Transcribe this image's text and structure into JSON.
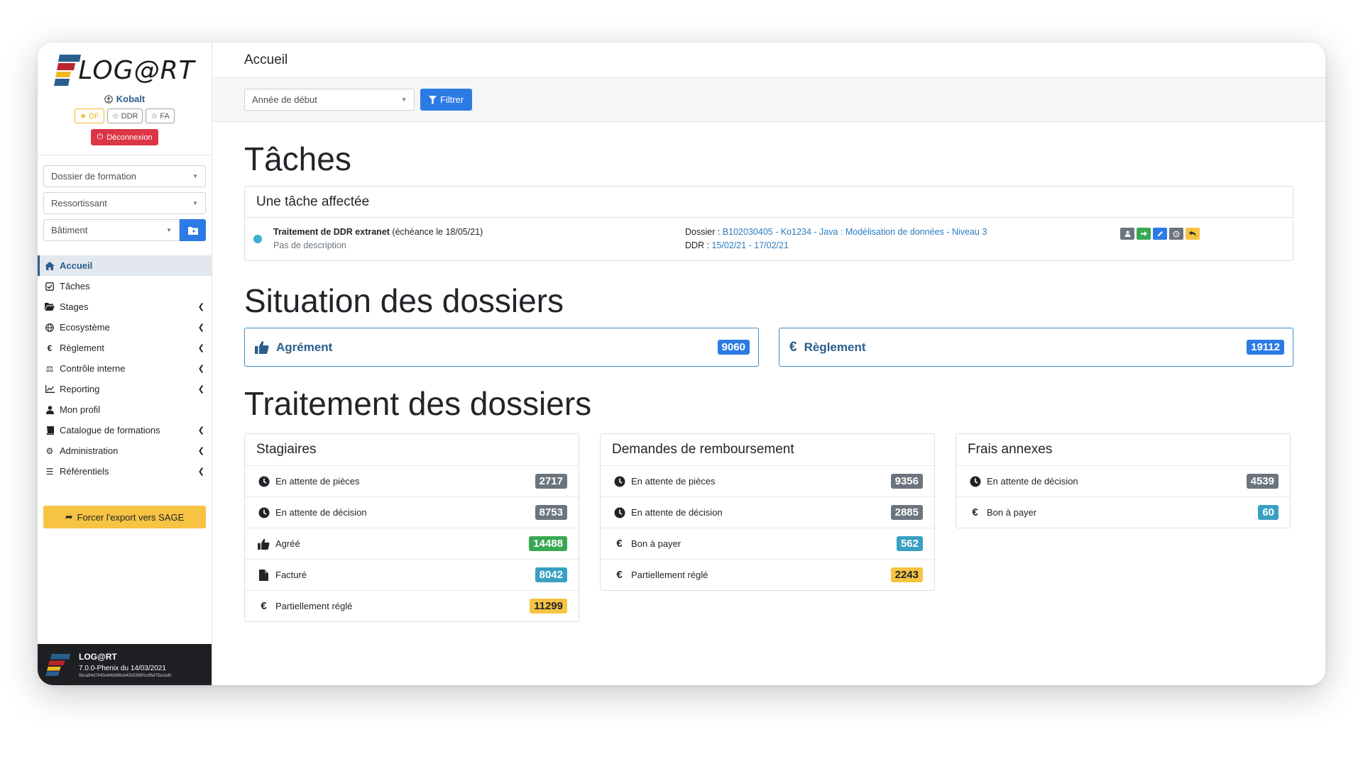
{
  "app": {
    "logo_text": "LOG@RT",
    "username": "Kobalt"
  },
  "user_badges": [
    {
      "label": "DF",
      "icon": "star-half-icon"
    },
    {
      "label": "DDR",
      "icon": "star-icon"
    },
    {
      "label": "FA",
      "icon": "star-icon"
    }
  ],
  "logout_label": "Déconnexion",
  "sidebar": {
    "selects": {
      "dossier": "Dossier de formation",
      "ressortissant": "Ressortissant",
      "batiment": "Bâtiment"
    },
    "nav": [
      {
        "label": "Accueil",
        "icon": "home-icon",
        "active": true,
        "submenu": false
      },
      {
        "label": "Tâches",
        "icon": "checkbox-icon",
        "submenu": false
      },
      {
        "label": "Stages",
        "icon": "folder-open-icon",
        "submenu": true
      },
      {
        "label": "Ecosystème",
        "icon": "globe-icon",
        "submenu": true
      },
      {
        "label": "Règlement",
        "icon": "euro-icon",
        "submenu": true
      },
      {
        "label": "Contrôle interne",
        "icon": "balance-scale-icon",
        "submenu": true
      },
      {
        "label": "Reporting",
        "icon": "line-chart-icon",
        "submenu": true
      },
      {
        "label": "Mon profil",
        "icon": "user-icon",
        "submenu": false
      },
      {
        "label": "Catalogue de formations",
        "icon": "book-icon",
        "submenu": true
      },
      {
        "label": "Administration",
        "icon": "cogs-icon",
        "submenu": true
      },
      {
        "label": "Référentiels",
        "icon": "list-icon",
        "submenu": true
      }
    ],
    "export_label": "Forcer l'export vers SAGE",
    "footer": {
      "title": "LOG@RT",
      "version": "7.0.0-Phenix du 14/03/2021",
      "hash": "5bca84d7840e84b586cb42b3388f1c86d75acbd0"
    }
  },
  "header": {
    "title": "Accueil"
  },
  "filter": {
    "year_placeholder": "Année de début",
    "button_label": "Filtrer"
  },
  "taches": {
    "title": "Tâches",
    "card_title": "Une tâche affectée",
    "task": {
      "name": "Traitement de DDR extranet",
      "deadline": "(échéance le 18/05/21)",
      "description": "Pas de description",
      "dossier_label": "Dossier :",
      "dossier_value": "B102030405 - Ko1234 - Java : Modélisation de données - Niveau 3",
      "ddr_label": "DDR :",
      "ddr_value": "15/02/21 - 17/02/21"
    }
  },
  "situation": {
    "title": "Situation des dossiers",
    "cards": [
      {
        "label": "Agrément",
        "value": "9060",
        "icon": "thumbs-up-icon"
      },
      {
        "label": "Règlement",
        "value": "19112",
        "icon": "euro-icon"
      }
    ]
  },
  "traitement": {
    "title": "Traitement des dossiers",
    "cards": [
      {
        "title": "Stagiaires",
        "items": [
          {
            "label": "En attente de pièces",
            "value": "2717",
            "icon": "clock-icon",
            "color": "gray"
          },
          {
            "label": "En attente de décision",
            "value": "8753",
            "icon": "clock-icon",
            "color": "gray"
          },
          {
            "label": "Agréé",
            "value": "14488",
            "icon": "thumbs-up-icon",
            "color": "green"
          },
          {
            "label": "Facturé",
            "value": "8042",
            "icon": "file-icon",
            "color": "teal"
          },
          {
            "label": "Partiellement réglé",
            "value": "11299",
            "icon": "euro-icon",
            "color": "yellow"
          }
        ]
      },
      {
        "title": "Demandes de remboursement",
        "items": [
          {
            "label": "En attente de pièces",
            "value": "9356",
            "icon": "clock-icon",
            "color": "gray"
          },
          {
            "label": "En attente de décision",
            "value": "2885",
            "icon": "clock-icon",
            "color": "gray"
          },
          {
            "label": "Bon à payer",
            "value": "562",
            "icon": "euro-icon",
            "color": "teal"
          },
          {
            "label": "Partiellement réglé",
            "value": "2243",
            "icon": "euro-icon",
            "color": "yellow"
          }
        ]
      },
      {
        "title": "Frais annexes",
        "items": [
          {
            "label": "En attente de décision",
            "value": "4539",
            "icon": "clock-icon",
            "color": "gray"
          },
          {
            "label": "Bon à payer",
            "value": "60",
            "icon": "euro-icon",
            "color": "teal"
          }
        ]
      }
    ]
  },
  "colors": {
    "primary": "#2c7be5",
    "danger": "#dc3545",
    "warning": "#f6c343",
    "brand": "#2a5e8c"
  }
}
